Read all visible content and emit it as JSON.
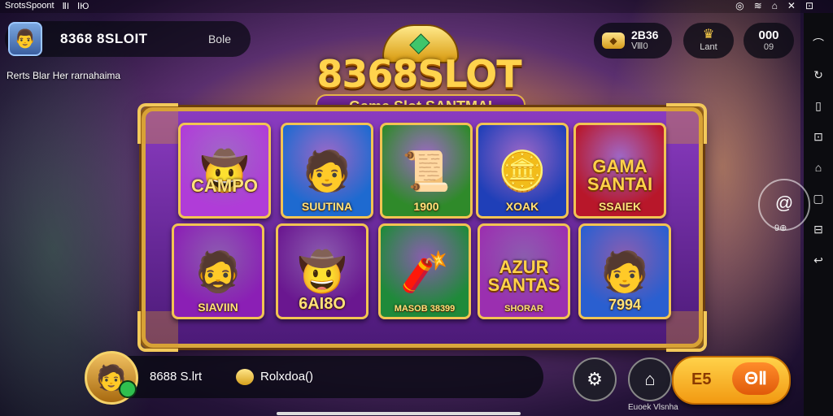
{
  "status_bar": {
    "app_name": "SrotsSpoont",
    "signal": "ⅡI",
    "carrier": "ⅠЮ",
    "icons_right": [
      "◎",
      "≋",
      "⌂",
      "✕",
      "⊡"
    ]
  },
  "profile": {
    "name": "8368 8SLOIT",
    "tag": "Bole",
    "avatar_icon": "👨"
  },
  "marquee": "Rerts Blar Her rarnahaima",
  "hud": {
    "coins": {
      "value": "2B36",
      "sub": "Ⅷ0",
      "icon": "coin-stack-icon"
    },
    "level": {
      "label": "Lant",
      "icon": "crown-icon"
    },
    "messages": {
      "value": "000",
      "sub": "09"
    }
  },
  "logo": {
    "title": "8368SLOT",
    "subtitle": "Game Slot SANTMAI"
  },
  "tiles": [
    {
      "caption": "CAMPO",
      "big": "",
      "art": "🤠",
      "bg": "#b03cd8"
    },
    {
      "caption": "SUUTINA",
      "big": "",
      "art": "🧑",
      "bg": "#1e6ad0"
    },
    {
      "caption": "1900",
      "big": "",
      "art": "📜",
      "bg": "#2f8a2a"
    },
    {
      "caption": "XOAK",
      "big": "",
      "art": "🪙",
      "bg": "#1f3fb8"
    },
    {
      "caption": "SSAIEK",
      "big": "GAMA SANTAI",
      "art": "",
      "bg": "#b8172a"
    },
    {
      "caption": "SIAVIIN",
      "big": "",
      "art": "🧔",
      "bg": "#8b1fb5"
    },
    {
      "caption": "6AI8O",
      "big": "",
      "art": "🤠",
      "bg": "#6a1790"
    },
    {
      "caption": "MASOB 38399",
      "big": "",
      "art": "🧨",
      "bg": "#1f8a3a"
    },
    {
      "caption": "SHORAR",
      "big": "AZUR SANTAS",
      "art": "",
      "bg": "#9b2fb0"
    },
    {
      "caption": "7994",
      "big": "",
      "art": "🧑",
      "bg": "#2a5fd0"
    }
  ],
  "bottom": {
    "name": "8688 S.lrt",
    "balance": "Rolxdoa()",
    "avatar_icon": "🧑"
  },
  "buttons": {
    "settings_icon": "⚙",
    "home_icon": "⌂",
    "label": "Euoek Vlsnha",
    "play_left": "E5",
    "play_right": "ΘⅡ"
  },
  "side": {
    "icon": "@",
    "label": "9⊕"
  },
  "sys_nav": [
    "⌒",
    "↻",
    "▯",
    "⊡",
    "⌂",
    "▢",
    "⊟",
    "↩"
  ]
}
